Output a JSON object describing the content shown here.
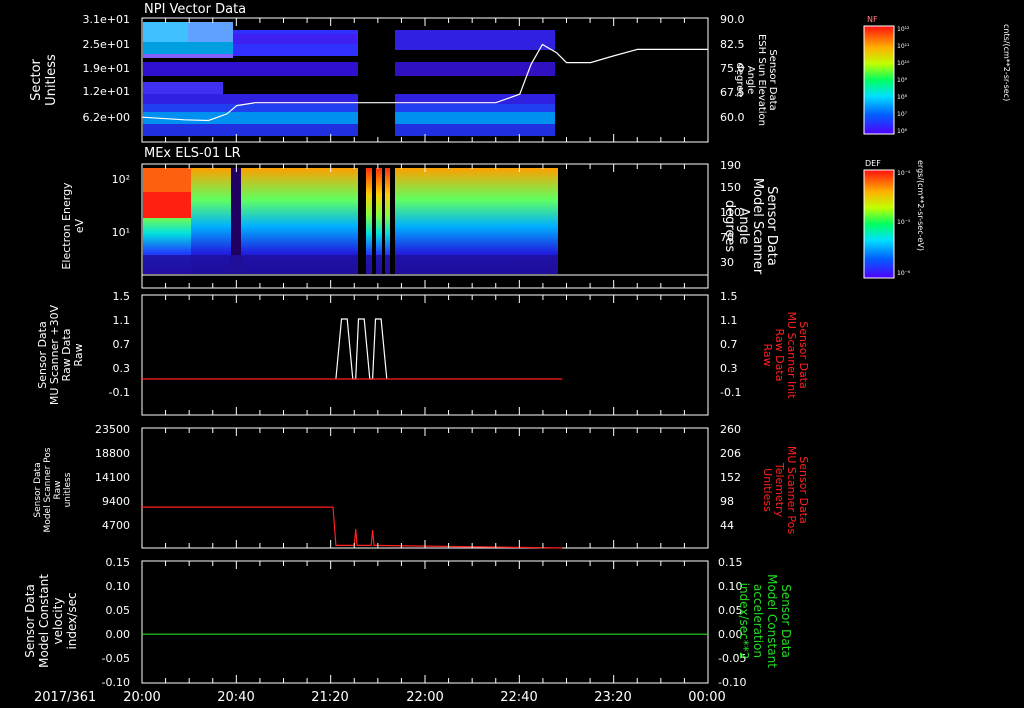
{
  "chart_data": [
    {
      "id": "npi",
      "type": "heatmap",
      "title": "NPI Vector Data",
      "ylabel": [
        "Sector",
        "Unitless"
      ],
      "yticks": [
        "3.1e+01",
        "2.5e+01",
        "1.9e+01",
        "1.2e+01",
        "6.2e+00"
      ],
      "y2label": [
        "Sensor Data",
        "ESH Sun Elevation",
        "Angle",
        "degree"
      ],
      "y2ticks": [
        "90.0",
        "82.5",
        "75.0",
        "67.5",
        "60.0"
      ],
      "y2lim": [
        52.5,
        90
      ],
      "colorbar": {
        "label": "NF",
        "unit": "cnts/(cm**2-sr-sec)",
        "ticks": [
          "10¹²",
          "10¹¹",
          "10¹⁰",
          "10⁹",
          "10⁸",
          "10⁷",
          "10⁶"
        ]
      },
      "overlay_line": {
        "color": "#ffffff",
        "x": [
          20.0,
          20.3,
          20.47,
          20.6,
          20.67,
          20.8,
          21.0,
          21.5,
          22.0,
          22.5,
          22.67,
          22.75,
          22.83,
          22.93,
          23.0,
          23.17,
          23.33,
          23.5,
          24.0
        ],
        "y": [
          60.0,
          59.2,
          59.0,
          61.0,
          63.5,
          64.4,
          64.4,
          64.4,
          64.4,
          64.4,
          67.0,
          76.0,
          82.0,
          79.5,
          76.5,
          76.5,
          78.5,
          80.5,
          80.5
        ]
      }
    },
    {
      "id": "els",
      "type": "heatmap",
      "title": "MEx ELS-01 LR",
      "ylabel": [
        "Electron Energy",
        "eV"
      ],
      "yticks": [
        "10²",
        "10¹"
      ],
      "y2label": [
        "Sensor Data",
        "Model Scanner",
        "Angle",
        "degrees"
      ],
      "y2ticks": [
        "190",
        "150",
        "110",
        "70",
        "30"
      ],
      "y2lim": [
        0,
        190
      ],
      "colorbar": {
        "label": "DEF",
        "unit": "ergs/(cm**2-sr-sec-eV)",
        "ticks": [
          "10⁻⁴",
          "10⁻⁵",
          "10⁻⁶"
        ]
      },
      "overlay_line": {
        "color": "#ffffff",
        "x": [
          20.0,
          24.0
        ],
        "y": [
          10,
          10
        ]
      }
    },
    {
      "id": "mu_raw",
      "type": "line",
      "ylabel": [
        "Sensor Data",
        "MU Scanner +30V",
        "Raw Data",
        "Raw"
      ],
      "yticks": [
        "1.5",
        "1.1",
        "0.7",
        "0.3",
        "-0.1"
      ],
      "ylim": [
        -0.5,
        1.5
      ],
      "y2label": [
        "Sensor Data",
        "MU Scanner Init",
        "Raw Data",
        "Raw"
      ],
      "y2ticks": [
        "1.5",
        "1.1",
        "0.7",
        "0.3",
        "-0.1"
      ],
      "y2lim": [
        -0.5,
        1.5
      ],
      "series": [
        {
          "color": "#ffffff",
          "x": [
            21.37,
            21.41,
            21.45,
            21.49,
            21.51,
            21.53,
            21.57,
            21.61,
            21.63,
            21.65,
            21.69,
            21.73
          ],
          "y": [
            0.1,
            1.1,
            1.1,
            0.1,
            0.1,
            1.1,
            1.1,
            0.1,
            0.1,
            1.1,
            1.1,
            0.1
          ]
        },
        {
          "color": "#ff2020",
          "x": [
            20.0,
            22.97
          ],
          "y": [
            0.1,
            0.1
          ]
        }
      ]
    },
    {
      "id": "mu_pos",
      "type": "line",
      "ylabel": [
        "Sensor Data",
        "Model Scanner Pos",
        "Raw",
        "unitless"
      ],
      "yticks": [
        "23500",
        "18800",
        "14100",
        "9400",
        "4700"
      ],
      "ylim": [
        0,
        23500
      ],
      "y2label": [
        "Sensor Data",
        "MU Scanner Pos",
        "Telemetry",
        "Unitless"
      ],
      "y2ticks": [
        "260",
        "206",
        "152",
        "98",
        "44"
      ],
      "y2lim": [
        0,
        260
      ],
      "series": [
        {
          "color": "#ff2020",
          "x": [
            20.0,
            21.35,
            21.37,
            21.5,
            21.51,
            21.52,
            21.53,
            21.62,
            21.63,
            21.64,
            21.65,
            22.97
          ],
          "y": [
            8000,
            8000,
            500,
            500,
            3700,
            500,
            500,
            500,
            3500,
            500,
            500,
            0
          ]
        }
      ]
    },
    {
      "id": "const",
      "type": "line",
      "ylabel": [
        "Sensor Data",
        "Model Constant",
        "velocity",
        "index/sec"
      ],
      "yticks": [
        "0.15",
        "0.10",
        "0.05",
        "0.00",
        "-0.05",
        "-0.10"
      ],
      "ylim": [
        -0.1,
        0.15
      ],
      "y2label": [
        "Sensor Data",
        "Model Constant",
        "acceleration",
        "index/sec**2"
      ],
      "y2ticks": [
        "0.15",
        "0.10",
        "0.05",
        "0.00",
        "-0.05",
        "-0.10"
      ],
      "y2lim": [
        -0.1,
        0.15
      ],
      "series": [
        {
          "color": "#22dd22",
          "x": [
            20.0,
            24.0
          ],
          "y": [
            0.0,
            0.0
          ]
        }
      ]
    }
  ],
  "x_axis": {
    "date": "2017/361",
    "ticks": [
      "20:00",
      "20:40",
      "21:20",
      "22:00",
      "22:40",
      "23:20",
      "00:00"
    ],
    "range_hours": [
      20,
      24
    ]
  },
  "colors": {
    "background": "#000000",
    "axes": "#ffffff",
    "red": "#ff2020",
    "green": "#22dd22"
  }
}
